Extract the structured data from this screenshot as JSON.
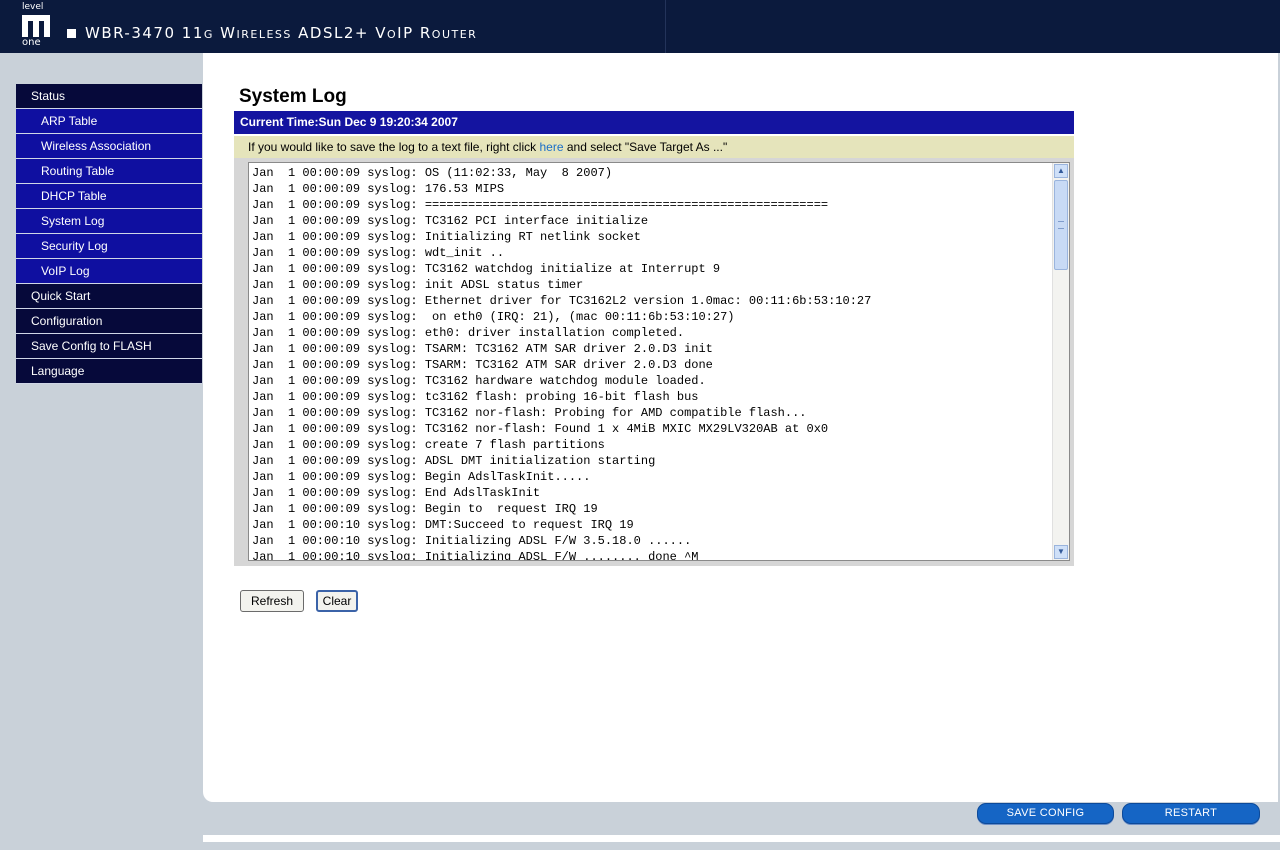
{
  "header": {
    "logo_top": "level",
    "logo_bottom": "one",
    "title": "WBR-3470 11g Wireless ADSL2+ VoIP Router"
  },
  "sidebar": {
    "items": [
      {
        "label": "Status",
        "level": "top"
      },
      {
        "label": "ARP Table",
        "level": "sub"
      },
      {
        "label": "Wireless Association",
        "level": "sub"
      },
      {
        "label": "Routing Table",
        "level": "sub"
      },
      {
        "label": "DHCP Table",
        "level": "sub"
      },
      {
        "label": "System Log",
        "level": "sub"
      },
      {
        "label": "Security Log",
        "level": "sub"
      },
      {
        "label": "VoIP Log",
        "level": "sub"
      },
      {
        "label": "Quick Start",
        "level": "top"
      },
      {
        "label": "Configuration",
        "level": "top"
      },
      {
        "label": "Save Config to FLASH",
        "level": "top"
      },
      {
        "label": "Language",
        "level": "top"
      }
    ]
  },
  "main": {
    "title": "System Log",
    "current_time": "Current Time:Sun Dec 9 19:20:34 2007",
    "hint_before": "If you would like to save the log to a text file, right click ",
    "hint_link": "here",
    "hint_after": " and select \"Save Target As ...\"",
    "log_lines": [
      "Jan  1 00:00:09 syslog: OS (11:02:33, May  8 2007)",
      "Jan  1 00:00:09 syslog: 176.53 MIPS",
      "Jan  1 00:00:09 syslog: ========================================================",
      "Jan  1 00:00:09 syslog: TC3162 PCI interface initialize",
      "Jan  1 00:00:09 syslog: Initializing RT netlink socket",
      "Jan  1 00:00:09 syslog: wdt_init ..",
      "Jan  1 00:00:09 syslog: TC3162 watchdog initialize at Interrupt 9",
      "Jan  1 00:00:09 syslog: init ADSL status timer",
      "Jan  1 00:00:09 syslog: Ethernet driver for TC3162L2 version 1.0mac: 00:11:6b:53:10:27",
      "Jan  1 00:00:09 syslog:  on eth0 (IRQ: 21), (mac 00:11:6b:53:10:27)",
      "Jan  1 00:00:09 syslog: eth0: driver installation completed.",
      "Jan  1 00:00:09 syslog: TSARM: TC3162 ATM SAR driver 2.0.D3 init",
      "Jan  1 00:00:09 syslog: TSARM: TC3162 ATM SAR driver 2.0.D3 done",
      "Jan  1 00:00:09 syslog: TC3162 hardware watchdog module loaded.",
      "Jan  1 00:00:09 syslog: tc3162 flash: probing 16-bit flash bus",
      "Jan  1 00:00:09 syslog: TC3162 nor-flash: Probing for AMD compatible flash...",
      "Jan  1 00:00:09 syslog: TC3162 nor-flash: Found 1 x 4MiB MXIC MX29LV320AB at 0x0",
      "Jan  1 00:00:09 syslog: create 7 flash partitions",
      "Jan  1 00:00:09 syslog: ADSL DMT initialization starting",
      "Jan  1 00:00:09 syslog: Begin AdslTaskInit.....",
      "Jan  1 00:00:09 syslog: End AdslTaskInit",
      "Jan  1 00:00:09 syslog: Begin to  request IRQ 19",
      "Jan  1 00:00:10 syslog: DMT:Succeed to request IRQ 19",
      "Jan  1 00:00:10 syslog: Initializing ADSL F/W 3.5.18.0 ......",
      "Jan  1 00:00:10 syslog: Initializing ADSL F/W ........ done ^M"
    ],
    "refresh_label": "Refresh",
    "clear_label": "Clear"
  },
  "footer": {
    "save_config_label": "SAVE CONFIG",
    "restart_label": "RESTART"
  },
  "colors": {
    "header_bg": "#0b1a3d",
    "nav_top_bg": "#06093a",
    "nav_sub_bg": "#0f0fa0",
    "time_bar_bg": "#1414a0",
    "hint_bg": "#e5e4bb",
    "pill_button_bg": "#1565c5"
  }
}
